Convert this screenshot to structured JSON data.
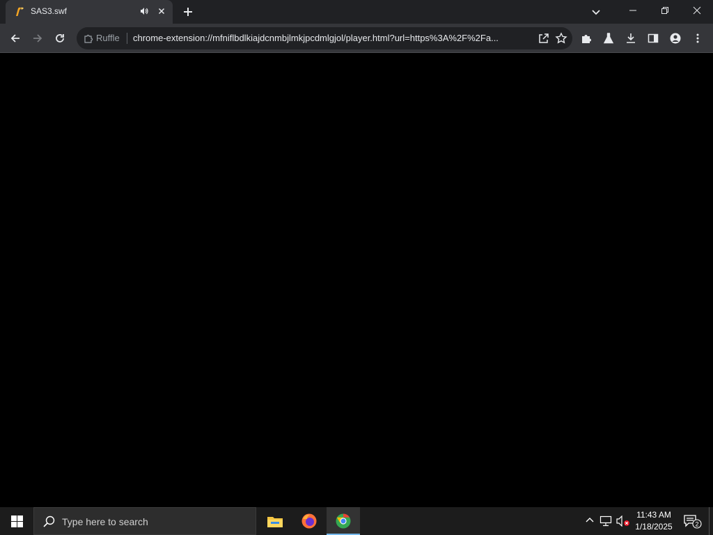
{
  "browser": {
    "tab": {
      "title": "SAS3.swf",
      "favicon": "ruffle-icon",
      "audio_icon": "speaker-playing-icon",
      "close_icon": "close-icon"
    },
    "new_tab_icon": "plus-icon",
    "tab_search_icon": "chevron-down-icon",
    "window_controls": [
      "minimize-icon",
      "restore-icon",
      "close-icon"
    ],
    "toolbar": {
      "back_icon": "back-arrow-icon",
      "forward_icon": "forward-arrow-icon",
      "reload_icon": "reload-icon",
      "omnibox": {
        "chip_label": "Ruffle",
        "url": "chrome-extension://mfniflbdlkiajdcnmbjlmkjpcdmlgjol/player.html?url=https%3A%2F%2Fa..."
      },
      "right_icons": [
        "share-icon",
        "star-icon",
        "extensions-icon",
        "labs-icon",
        "download-icon",
        "side-panel-icon",
        "profile-icon",
        "menu-icon"
      ]
    }
  },
  "taskbar": {
    "search_placeholder": "Type here to search",
    "apps": [
      "file-explorer-icon",
      "firefox-icon",
      "chrome-icon"
    ],
    "clock": {
      "time": "11:43 AM",
      "date": "1/18/2025"
    },
    "notification_count": "2"
  },
  "colors": {
    "tabstrip": "#202124",
    "toolbar": "#35363a",
    "content": "#000000",
    "taskbar": "#1c1c1c"
  }
}
